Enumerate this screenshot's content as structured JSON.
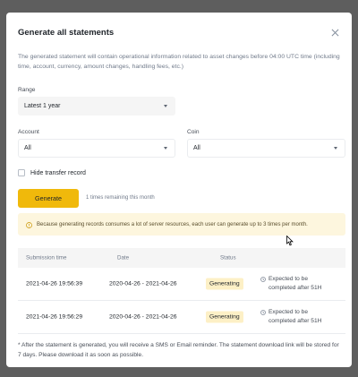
{
  "modal": {
    "title": "Generate all statements",
    "description": "The generated statement will contain operational information related to asset changes before 04:00 UTC time (including time, account, currency, amount changes, handling fees, etc.)"
  },
  "form": {
    "range_label": "Range",
    "range_value": "Latest 1 year",
    "account_label": "Account",
    "account_value": "All",
    "coin_label": "Coin",
    "coin_value": "All",
    "hide_transfer_label": "Hide transfer record"
  },
  "generate": {
    "button_label": "Generate",
    "remaining_text": "1 times remaining this month"
  },
  "notice": {
    "text": "Because generating records consumes a lot of server resources, each user can generate up to 3 times per month."
  },
  "table": {
    "headers": [
      "Submission time",
      "Date",
      "Status"
    ],
    "rows": [
      {
        "submission": "2021-04-26 19:56:39",
        "date": "2020-04-26 - 2021-04-26",
        "status": "Generating",
        "expected_line1": "Expected to be",
        "expected_line2": "completed after 51H"
      },
      {
        "submission": "2021-04-26 19:56:29",
        "date": "2020-04-26 - 2021-04-26",
        "status": "Generating",
        "expected_line1": "Expected to be",
        "expected_line2": "completed after 51H"
      }
    ]
  },
  "footer": {
    "text": "* After the statement is generated, you will receive a SMS or Email reminder. The statement download link will be stored for 7 days. Please download it as soon as possible."
  },
  "colors": {
    "accent": "#F0B90B",
    "notice_bg": "#FDF6DE",
    "badge_bg": "#FDF0C6",
    "overlay": "#5E5E5E"
  },
  "icons": [
    "close-icon",
    "info-icon",
    "clock-icon",
    "chevron-down-icon",
    "cursor-icon"
  ]
}
